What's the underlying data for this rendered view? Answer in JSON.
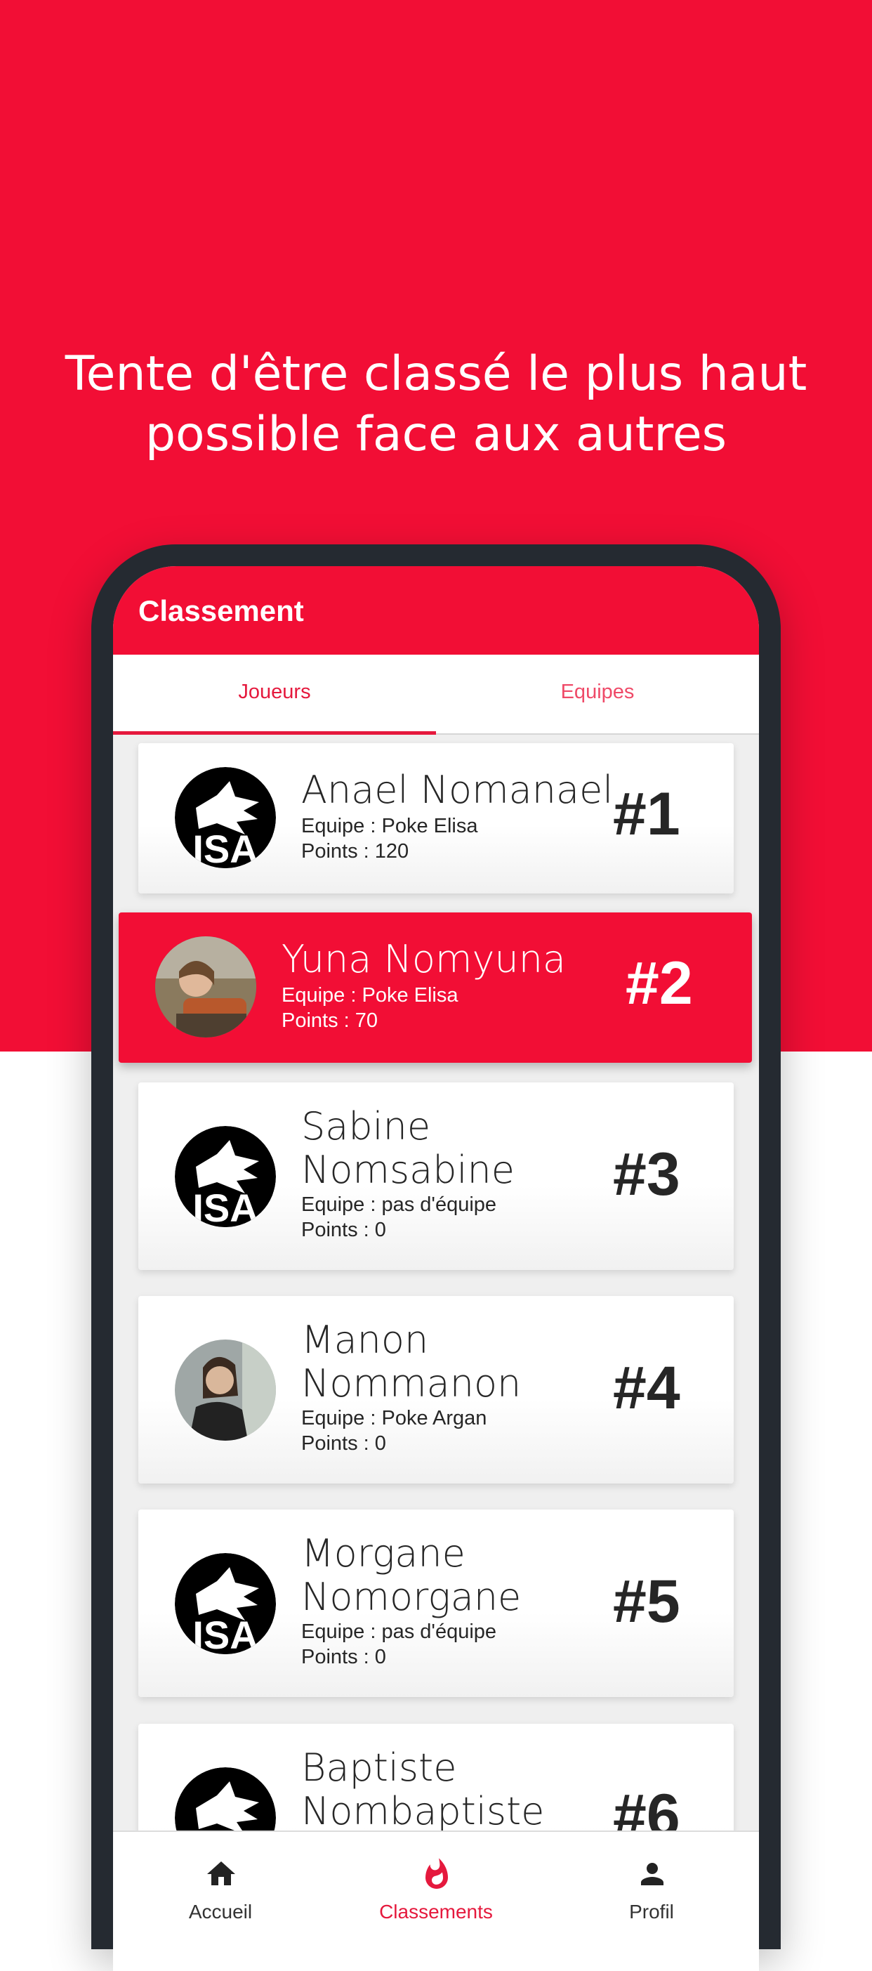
{
  "headline": {
    "line1": "Tente d'être classé le plus haut",
    "line2": "possible face aux autres"
  },
  "appbar": {
    "title": "Classement"
  },
  "tabs": [
    {
      "label": "Joueurs",
      "active": true
    },
    {
      "label": "Equipes",
      "active": false
    }
  ],
  "players": [
    {
      "name_line1": "Anael Nomanael",
      "name_line2": "",
      "team": "Equipe : Poke Elisa",
      "points": "Points : 120",
      "rank": "#1",
      "avatar": "isa-logo",
      "highlight": false
    },
    {
      "name_line1": "Yuna Nomyuna",
      "name_line2": "",
      "team": "Equipe : Poke Elisa",
      "points": "Points : 70",
      "rank": "#2",
      "avatar": "photo",
      "highlight": true
    },
    {
      "name_line1": "Sabine",
      "name_line2": "Nomsabine",
      "team": "Equipe : pas d'équipe",
      "points": "Points : 0",
      "rank": "#3",
      "avatar": "isa-logo",
      "highlight": false
    },
    {
      "name_line1": "Manon",
      "name_line2": "Nommanon",
      "team": "Equipe : Poke Argan",
      "points": "Points : 0",
      "rank": "#4",
      "avatar": "photo",
      "highlight": false
    },
    {
      "name_line1": "Morgane",
      "name_line2": "Nomorgane",
      "team": "Equipe : pas d'équipe",
      "points": "Points : 0",
      "rank": "#5",
      "avatar": "isa-logo",
      "highlight": false
    },
    {
      "name_line1": "Baptiste",
      "name_line2": "Nombaptiste",
      "team": "",
      "points": "",
      "rank": "#6",
      "avatar": "isa-logo",
      "highlight": false
    }
  ],
  "bottom_nav": [
    {
      "label": "Accueil",
      "icon": "home-icon",
      "active": false
    },
    {
      "label": "Classements",
      "icon": "flame-icon",
      "active": true
    },
    {
      "label": "Profil",
      "icon": "person-icon",
      "active": false
    }
  ],
  "colors": {
    "brand_red": "#f20e35",
    "phone_frame": "#252a31",
    "text_dark": "#262626"
  }
}
